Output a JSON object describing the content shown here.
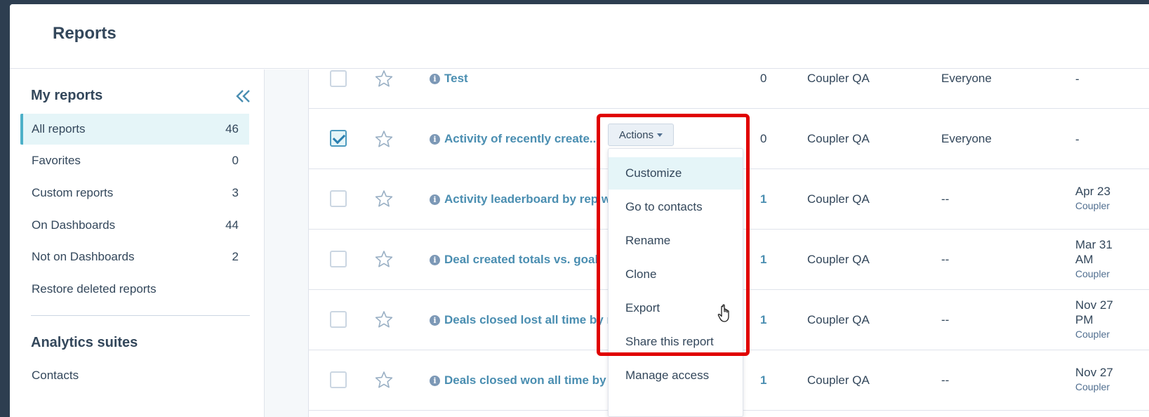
{
  "header": {
    "title": "Reports"
  },
  "sidebar": {
    "heading": "My reports",
    "items": [
      {
        "label": "All reports",
        "count": "46"
      },
      {
        "label": "Favorites",
        "count": "0"
      },
      {
        "label": "Custom reports",
        "count": "3"
      },
      {
        "label": "On Dashboards",
        "count": "44"
      },
      {
        "label": "Not on Dashboards",
        "count": "2"
      },
      {
        "label": "Restore deleted reports",
        "count": ""
      }
    ],
    "suites_heading": "Analytics suites",
    "suites": [
      {
        "label": "Contacts"
      }
    ]
  },
  "table": {
    "rows": [
      {
        "name": "Test",
        "count": "0",
        "owner": "Coupler QA",
        "access": "Everyone",
        "date": "-",
        "date2": "",
        "date_sub": ""
      },
      {
        "name": "Activity of recently create...",
        "count": "0",
        "owner": "Coupler QA",
        "access": "Everyone",
        "date": "-",
        "date2": "",
        "date_sub": ""
      },
      {
        "name": "Activity leaderboard by rep w",
        "count": "1",
        "owner": "Coupler QA",
        "access": "--",
        "date": "Apr 23",
        "date2": "",
        "date_sub": "Coupler"
      },
      {
        "name": "Deal created totals vs. goal",
        "count": "1",
        "owner": "Coupler QA",
        "access": "--",
        "date": "Mar 31",
        "date2": "AM",
        "date_sub": "Coupler"
      },
      {
        "name": "Deals closed lost all time by r",
        "count": "1",
        "owner": "Coupler QA",
        "access": "--",
        "date": "Nov 27",
        "date2": "PM",
        "date_sub": "Coupler"
      },
      {
        "name": "Deals closed won all time by r",
        "count": "1",
        "owner": "Coupler QA",
        "access": "--",
        "date": "Nov 27",
        "date2": "",
        "date_sub": "Coupler"
      }
    ]
  },
  "actions": {
    "button_label": "Actions",
    "menu": [
      {
        "label": "Customize"
      },
      {
        "label": "Go to contacts"
      },
      {
        "label": "Rename"
      },
      {
        "label": "Clone"
      },
      {
        "label": "Export"
      },
      {
        "label": "Share this report"
      },
      {
        "label": "Manage access"
      }
    ]
  },
  "colors": {
    "accent": "#4a8eb1",
    "highlight": "#e00000",
    "active_bg": "#e5f5f8",
    "text": "#33475b"
  }
}
